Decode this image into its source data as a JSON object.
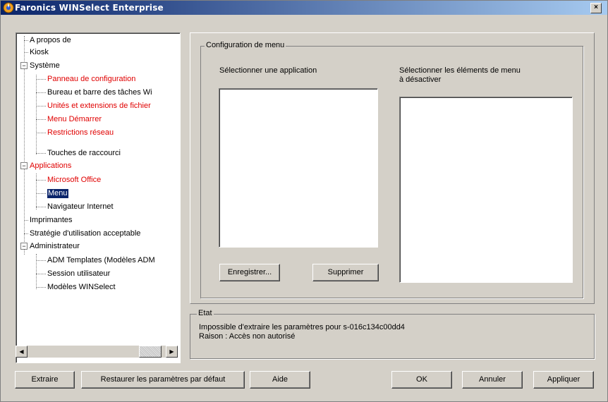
{
  "window": {
    "title": "Faronics WINSelect Enterprise",
    "close_symbol": "×"
  },
  "tree": {
    "items": [
      {
        "label": "A propos de"
      },
      {
        "label": "Kiosk"
      },
      {
        "label": "Système"
      },
      {
        "label": "Panneau de configuration"
      },
      {
        "label": "Bureau et barre des tâches Wi"
      },
      {
        "label": "Unités et extensions de fichier"
      },
      {
        "label": "Menu Démarrer"
      },
      {
        "label": "Restrictions réseau"
      },
      {
        "label": "Touches de raccourci"
      },
      {
        "label": "Applications"
      },
      {
        "label": "Microsoft Office"
      },
      {
        "label": "Menu"
      },
      {
        "label": "Navigateur Internet"
      },
      {
        "label": "Imprimantes"
      },
      {
        "label": "Stratégie d'utilisation acceptable"
      },
      {
        "label": "Administrateur"
      },
      {
        "label": "ADM Templates (Modèles ADM"
      },
      {
        "label": "Session utilisateur"
      },
      {
        "label": "Modèles WINSelect"
      }
    ],
    "toggle_symbol": "−",
    "scroll_left": "◀",
    "scroll_right": "▶"
  },
  "config": {
    "group_title": "Configuration de menu",
    "select_app_label": "Sélectionner une application",
    "select_items_label_1": "Sélectionner les éléments de menu",
    "select_items_label_2": "à désactiver",
    "save_label": "Enregistrer...",
    "delete_label": "Supprimer"
  },
  "status": {
    "group_title": "Etat",
    "line1": "Impossible d'extraire les paramètres pour s-016c134c00dd4",
    "line2": "Raison : Accès non autorisé"
  },
  "buttons": {
    "extract": "Extraire",
    "restore": "Restaurer les paramètres par défaut",
    "help": "Aide",
    "ok": "OK",
    "cancel": "Annuler",
    "apply": "Appliquer"
  },
  "colors": {
    "title_start": "#0a246a",
    "title_end": "#a6caf0",
    "highlight_text": "#e00000",
    "face": "#d4d0c8"
  }
}
